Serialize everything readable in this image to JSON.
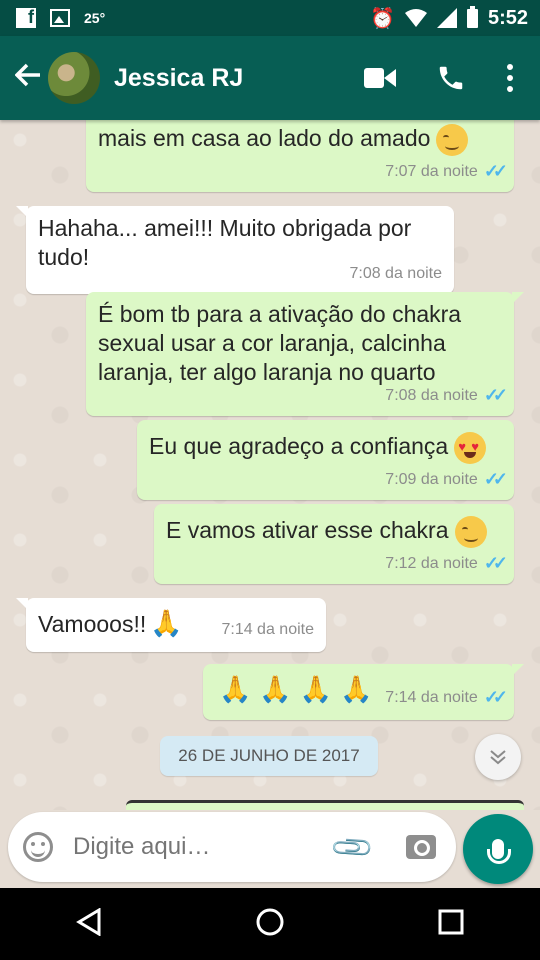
{
  "status_bar": {
    "temperature": "25°",
    "time": "5:52",
    "icons": [
      "facebook-icon",
      "gallery-icon",
      "alarm-icon",
      "wifi-icon",
      "signal-icon",
      "battery-icon"
    ]
  },
  "header": {
    "contact_name": "Jessica RJ",
    "icons": [
      "back-arrow-icon",
      "video-call-icon",
      "phone-icon",
      "more-options-icon"
    ]
  },
  "messages": [
    {
      "direction": "out",
      "text": "mais em casa ao lado do amado",
      "emoji": "smiling-blush",
      "time": "7:07 da noite",
      "read": true
    },
    {
      "direction": "in",
      "text": "Hahaha... amei!!! Muito obrigada por tudo!",
      "time": "7:08 da noite"
    },
    {
      "direction": "out",
      "text": "É bom tb para a ativação do chakra sexual usar a cor laranja, calcinha laranja, ter algo laranja no quarto",
      "time": "7:08 da noite",
      "read": true
    },
    {
      "direction": "out",
      "text": "Eu que agradeço a confiança",
      "emoji": "heart-eyes",
      "time": "7:09 da noite",
      "read": true
    },
    {
      "direction": "out",
      "text": "E vamos ativar esse chakra",
      "emoji": "smiling-blush",
      "time": "7:12 da noite",
      "read": true
    },
    {
      "direction": "in",
      "text": "Vamooos!!",
      "emoji": "folded-hands",
      "time": "7:14 da noite"
    },
    {
      "direction": "out",
      "text": "",
      "emoji": "folded-hands x4",
      "time": "7:14 da noite",
      "read": true
    }
  ],
  "date_chip": "26 DE JUNHO DE 2017",
  "input": {
    "placeholder": "Digite aqui…"
  },
  "colors": {
    "header": "#075e54",
    "status_bar": "#054d44",
    "outgoing_bubble": "#dcf8c6",
    "incoming_bubble": "#ffffff",
    "read_ticks": "#4fb6ec",
    "mic_button": "#00897b"
  }
}
